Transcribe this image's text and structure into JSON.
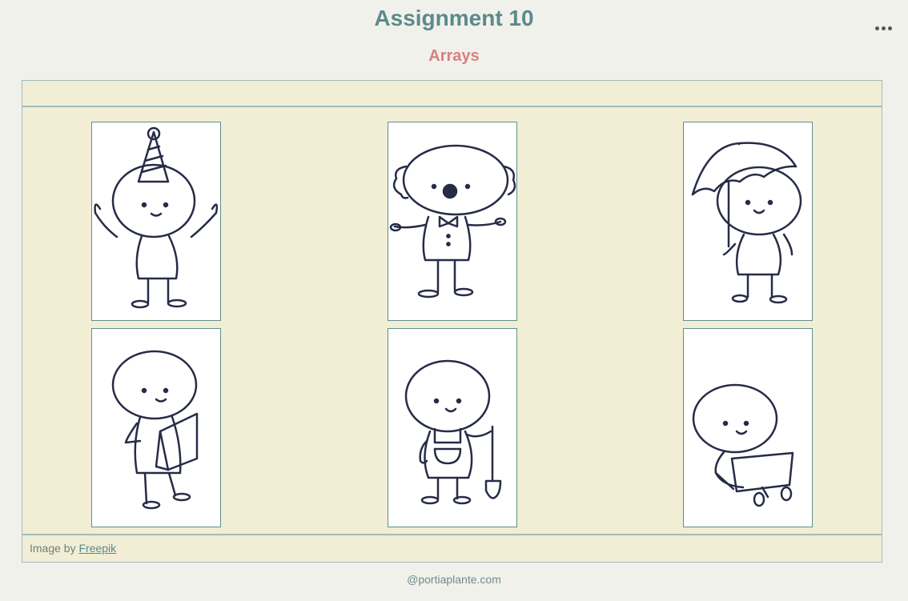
{
  "header": {
    "title": "Assignment 10",
    "subtitle": "Arrays"
  },
  "menu": {
    "icon": "more-horizontal-icon"
  },
  "gallery": {
    "cards": [
      {
        "icon": "party-hat-figure-icon"
      },
      {
        "icon": "clown-figure-icon"
      },
      {
        "icon": "umbrella-figure-icon"
      },
      {
        "icon": "reading-figure-icon"
      },
      {
        "icon": "gardener-figure-icon"
      },
      {
        "icon": "laptop-figure-icon"
      }
    ],
    "footer_prefix": "Image by",
    "footer_link": "Freepik"
  },
  "credit": "@portiaplante.com",
  "colors": {
    "title": "#5b8a8c",
    "subtitle": "#db7f7f",
    "panel": "#f1eed5",
    "border": "#9fbcbc",
    "ink": "#262c47"
  }
}
